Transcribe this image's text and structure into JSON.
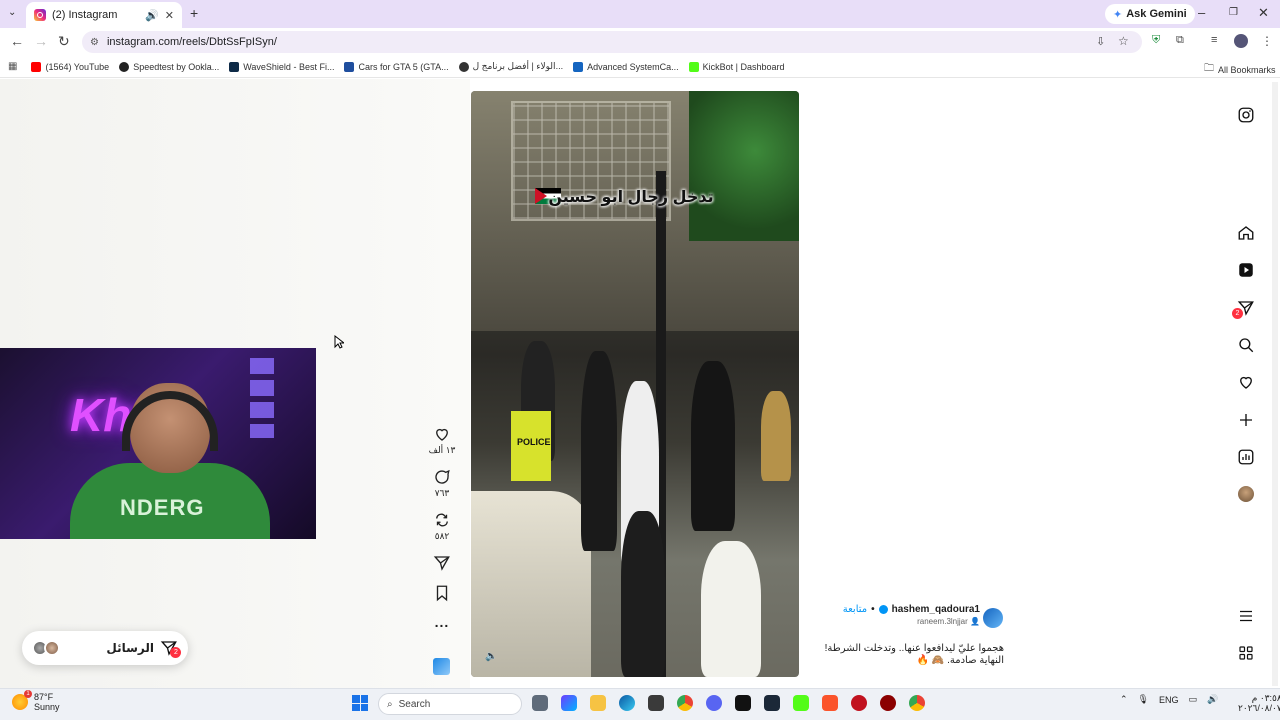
{
  "browser": {
    "tab_title": "(2) Instagram",
    "new_tab": "+",
    "ask_gemini": "Ask Gemini",
    "url": "instagram.com/reels/DbtSsFpISyn/",
    "bookmarks": [
      {
        "label": "(1564) YouTube",
        "color": "#ff0000"
      },
      {
        "label": "Speedtest by Ookla...",
        "color": "#222222"
      },
      {
        "label": "WaveShield - Best Fi...",
        "color": "#0e2a47"
      },
      {
        "label": "Cars for GTA 5 (GTA...",
        "color": "#1f4e9e"
      },
      {
        "label": "الولاء | أفضل برنامج ل...",
        "color": "#333333"
      },
      {
        "label": "Advanced SystemCa...",
        "color": "#1565c0"
      },
      {
        "label": "KickBot | Dashboard",
        "color": "#53fc18"
      }
    ],
    "all_bookmarks": "All Bookmarks"
  },
  "reel": {
    "video_caption": "تدخل رجال ابو حسين",
    "police_label": "POLICE",
    "likes": "١٣ ألف",
    "comments": "٧٦٣",
    "reposts": "٥٨٢",
    "more": "...",
    "author_username": "hashem_qadoura1",
    "follow_label": "متابعة",
    "separator": "•",
    "collab_username": "raneem.3lnjjar",
    "caption_line1": "هجموا عليّ ليدافعوا عنها.. وتدخلت الشرطة!",
    "caption_line2": "النهاية صادمة. 🙈 🔥"
  },
  "sidebar": {
    "messages_badge": "2"
  },
  "messages_pill": {
    "label": "الرسائل",
    "badge": "2"
  },
  "webcam": {
    "neon_text": "Kho",
    "shirt_text": "NDERG"
  },
  "taskbar": {
    "weather_temp": "87°F",
    "weather_desc": "Sunny",
    "weather_badge": "1",
    "search_placeholder": "Search",
    "lang": "ENG",
    "time": "٠٣:٥٨ م",
    "date": "٢٠٢٦/٠٨/٠٧"
  },
  "colors": {
    "accent_blue": "#0095f6",
    "badge_red": "#ff3040",
    "tab_strip": "#e8def8"
  }
}
